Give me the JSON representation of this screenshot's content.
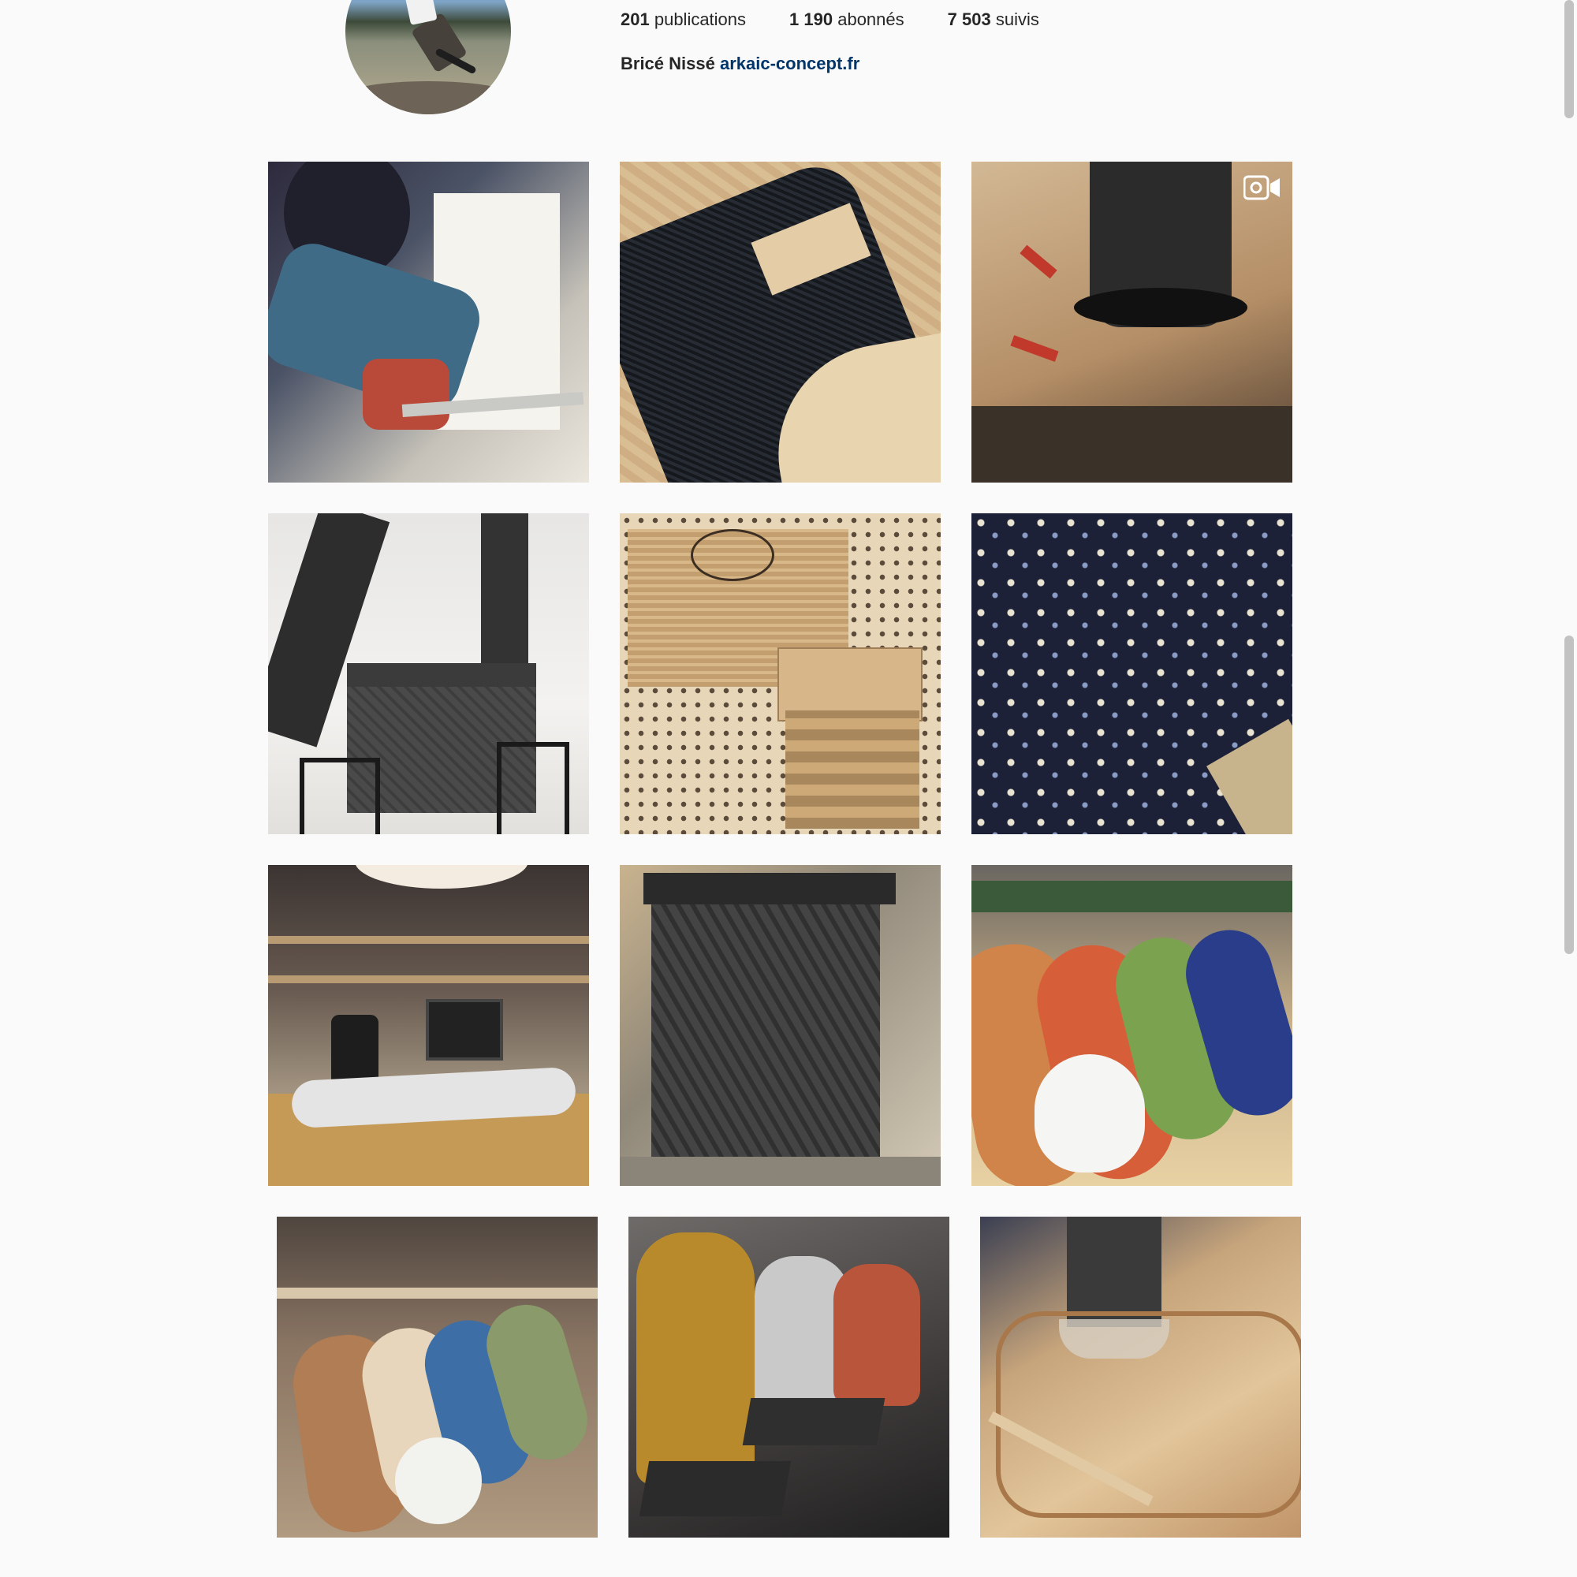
{
  "profile": {
    "stats": {
      "posts_count": "201",
      "posts_label": "publications",
      "followers_count": "1 190",
      "followers_label": "abonnés",
      "following_count": "7 503",
      "following_label": "suivis"
    },
    "full_name": "Bricé Nissé",
    "website": "arkaic-concept.fr"
  },
  "grid": {
    "rows": 4,
    "columns": 3,
    "video_indicator_on": "post-3",
    "icons": [
      "video-icon"
    ]
  },
  "colors": {
    "background": "#fafafa",
    "text": "#262626",
    "link": "#003569"
  }
}
